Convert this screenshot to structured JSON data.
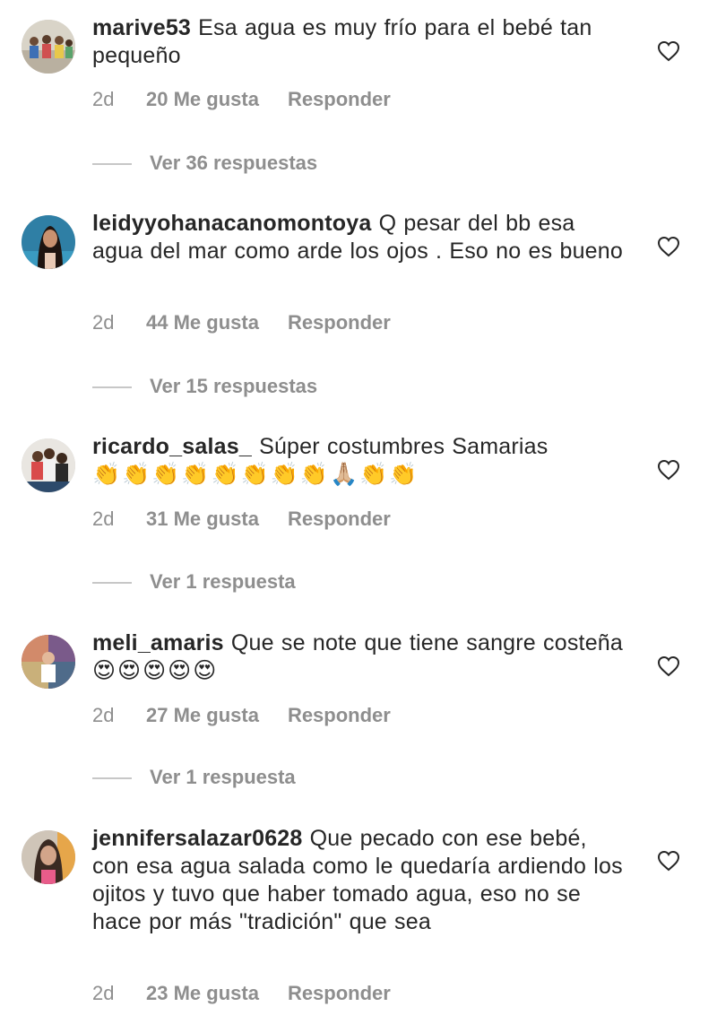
{
  "colors": {
    "text": "#262626",
    "secondary": "#8e8e8e",
    "divider": "#c7c7c7"
  },
  "comments": [
    {
      "username": "marive53",
      "text": " Esa agua es muy frío para el bebé tan pequeño",
      "time": "2d",
      "likes": "20 Me gusta",
      "reply_label": "Responder",
      "view_replies": "Ver 36 respuestas",
      "avatar_icon": "group-photo-avatar"
    },
    {
      "username": "leidyyohanacanomontoya",
      "text": " Q pesar del bb esa agua del mar como arde los ojos . Eso no es bueno",
      "time": "2d",
      "likes": "44 Me gusta",
      "reply_label": "Responder",
      "view_replies": "Ver 15 respuestas",
      "avatar_icon": "woman-portrait-avatar"
    },
    {
      "username": "ricardo_salas_",
      "text": " Súper costumbres Samarias",
      "emojis": "👏👏👏👏👏👏👏👏🙏🏼👏👏",
      "time": "2d",
      "likes": "31 Me gusta",
      "reply_label": "Responder",
      "view_replies": "Ver 1 respuesta",
      "avatar_icon": "family-photo-avatar"
    },
    {
      "username": "meli_amaris",
      "text": " Que se note que tiene sangre costeña",
      "emojis": "😍😍😍😍😍",
      "time": "2d",
      "likes": "27 Me gusta",
      "reply_label": "Responder",
      "view_replies": "Ver 1 respuesta",
      "avatar_icon": "collage-avatar"
    },
    {
      "username": "jennifersalazar0628",
      "text": " Que pecado con ese bebé, con esa agua salada como le quedaría ardiendo los ojitos y tuvo que haber tomado agua, eso no se hace por más \"tradición\" que sea",
      "time": "2d",
      "likes": "23 Me gusta",
      "reply_label": "Responder",
      "avatar_icon": "woman-selfie-avatar"
    }
  ]
}
